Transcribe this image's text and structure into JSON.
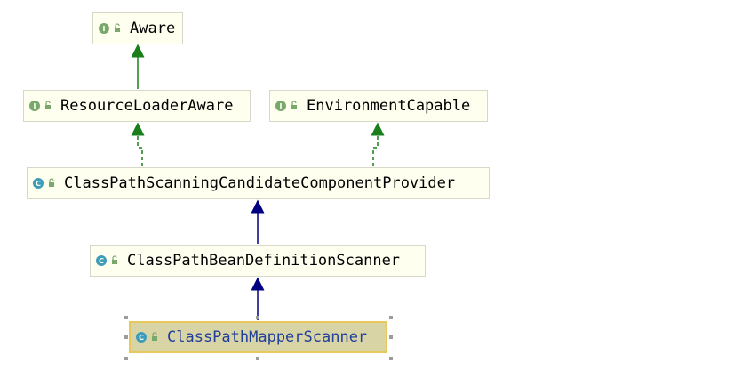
{
  "nodes": {
    "aware": {
      "label": "Aware",
      "kind": "interface",
      "badge": "I"
    },
    "resource_loader_aware": {
      "label": "ResourceLoaderAware",
      "kind": "interface",
      "badge": "I"
    },
    "environment_capable": {
      "label": "EnvironmentCapable",
      "kind": "interface",
      "badge": "I"
    },
    "provider": {
      "label": "ClassPathScanningCandidateComponentProvider",
      "kind": "class",
      "badge": "C"
    },
    "bean_definition_scanner": {
      "label": "ClassPathBeanDefinitionScanner",
      "kind": "class",
      "badge": "C"
    },
    "mapper_scanner": {
      "label": "ClassPathMapperScanner",
      "kind": "class",
      "badge": "C",
      "selected": true
    }
  },
  "edges": [
    {
      "from": "resource_loader_aware",
      "to": "aware",
      "type": "extends"
    },
    {
      "from": "provider",
      "to": "resource_loader_aware",
      "type": "implements"
    },
    {
      "from": "provider",
      "to": "environment_capable",
      "type": "implements"
    },
    {
      "from": "bean_definition_scanner",
      "to": "provider",
      "type": "extends"
    },
    {
      "from": "mapper_scanner",
      "to": "bean_definition_scanner",
      "type": "extends"
    }
  ],
  "colors": {
    "node_background": "#fffff0",
    "node_border": "#d8d8c8",
    "selected_background": "#d9d4a6",
    "selected_border": "#e8c85a",
    "selected_text": "#1f3f9a",
    "interface_arrow": "#1a7f1a",
    "class_arrow": "#000080",
    "interface_badge": "#79a86b",
    "class_badge": "#3d9db8"
  },
  "icons": {
    "interface": "interface-icon",
    "class": "class-icon",
    "visibility": "lock-icon"
  }
}
